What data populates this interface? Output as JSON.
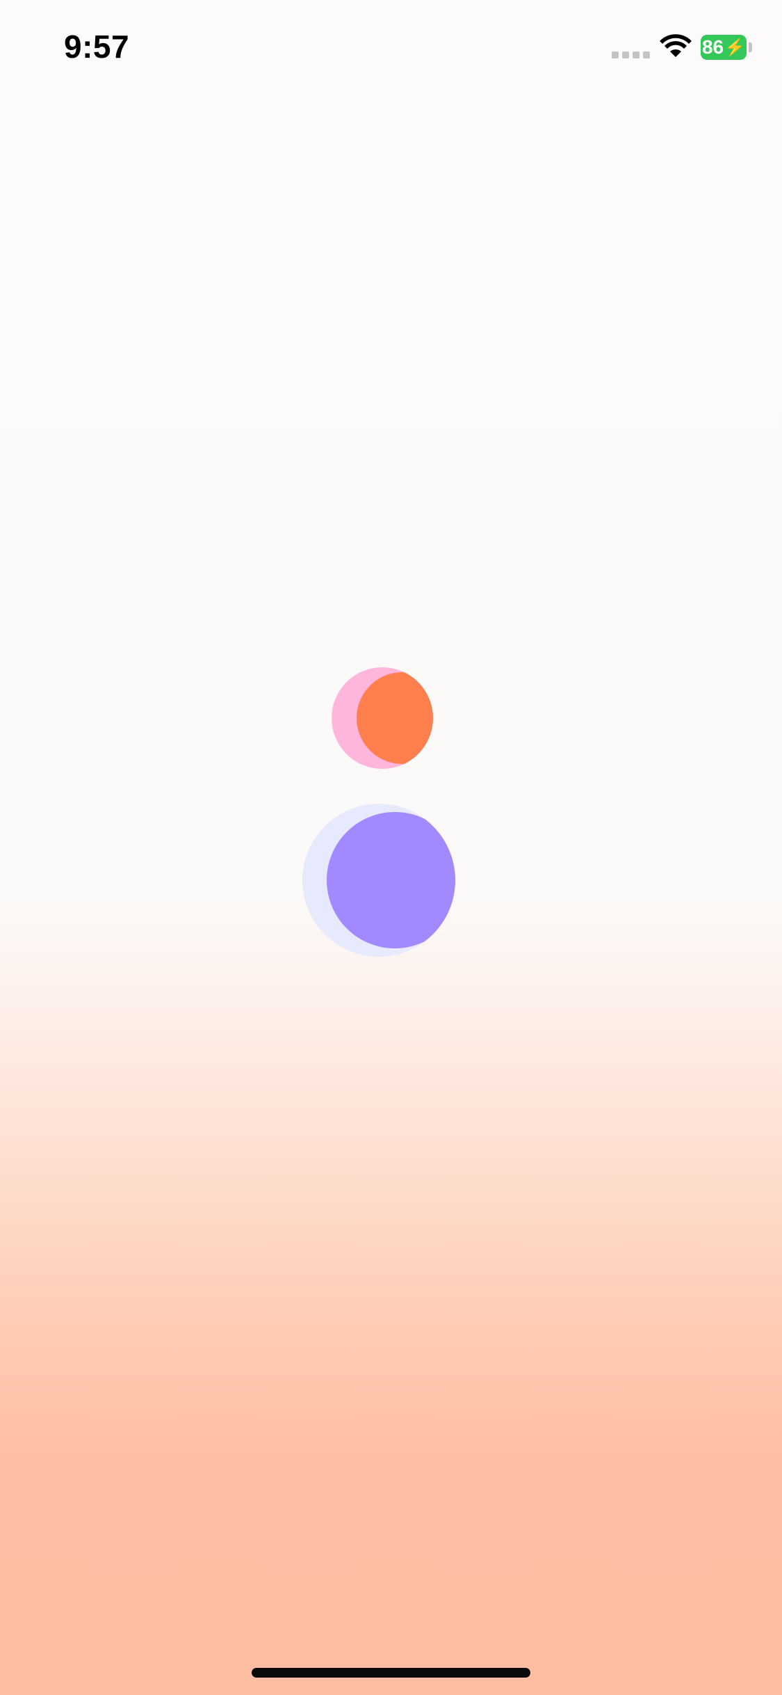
{
  "status_bar": {
    "time": "9:57",
    "battery_level": "86",
    "battery_charging": true,
    "battery_color": "#34c759",
    "icons": [
      "signal-icon",
      "wifi-icon",
      "battery-icon"
    ]
  },
  "splash": {
    "logo_icon": "two-overlapping-moon-circles-icon",
    "colors": {
      "top_back_circle": "#ffb5dc",
      "top_front_circle": "#ff7f4e",
      "bottom_back_circle": "#e7eafd",
      "bottom_front_circle": "#a389ff",
      "background_top": "#fcfbfa",
      "background_bottom": "#ffbea2"
    }
  }
}
